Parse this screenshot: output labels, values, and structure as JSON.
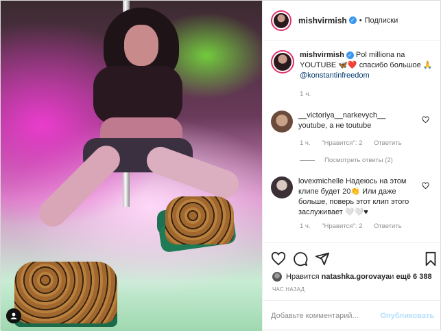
{
  "post": {
    "author": "mishvirmish",
    "separator": "•",
    "follow_label": "Подписки",
    "caption": {
      "username": "mishvirmish",
      "text_before": " Pol milliona na YOUTUBE ",
      "emoji": "🦋❤️",
      "text_after": " спасибо большое 🙏 ",
      "mention": "@konstantinfreedom",
      "time": "1 ч."
    },
    "comments": [
      {
        "username": "__victoriya__narkevych__",
        "text": "youtube, а не toutube",
        "time": "1 ч.",
        "likes": "\"Нравится\": 2",
        "reply": "Ответить"
      },
      {
        "username": "lovexmichelle",
        "text": "Надеюсь на этом клипе будет 20👏 Или даже больше, поверь этот клип этого заслуживает 🤍🤍♥",
        "time": "1 ч.",
        "likes": "\"Нравится\": 2",
        "reply": "Ответить"
      }
    ],
    "view_replies": "Посмотреть ответы (2)",
    "likes": {
      "prefix": "Нравится ",
      "user": "natashka.gorovaya",
      "middle": " и ",
      "count": "ещё 6 388"
    },
    "ago": "ЧАС НАЗАД",
    "add_comment": {
      "placeholder": "Добавьте комментарий...",
      "publish": "Опубликовать"
    },
    "colors": {
      "verified": "#3897f0",
      "mention": "#00376b",
      "muted": "#8e8e8e",
      "publish_disabled": "#b2dffc"
    },
    "icons": [
      "heart-icon",
      "comment-icon",
      "share-icon",
      "bookmark-icon",
      "user-tag-icon",
      "verified-icon"
    ]
  }
}
